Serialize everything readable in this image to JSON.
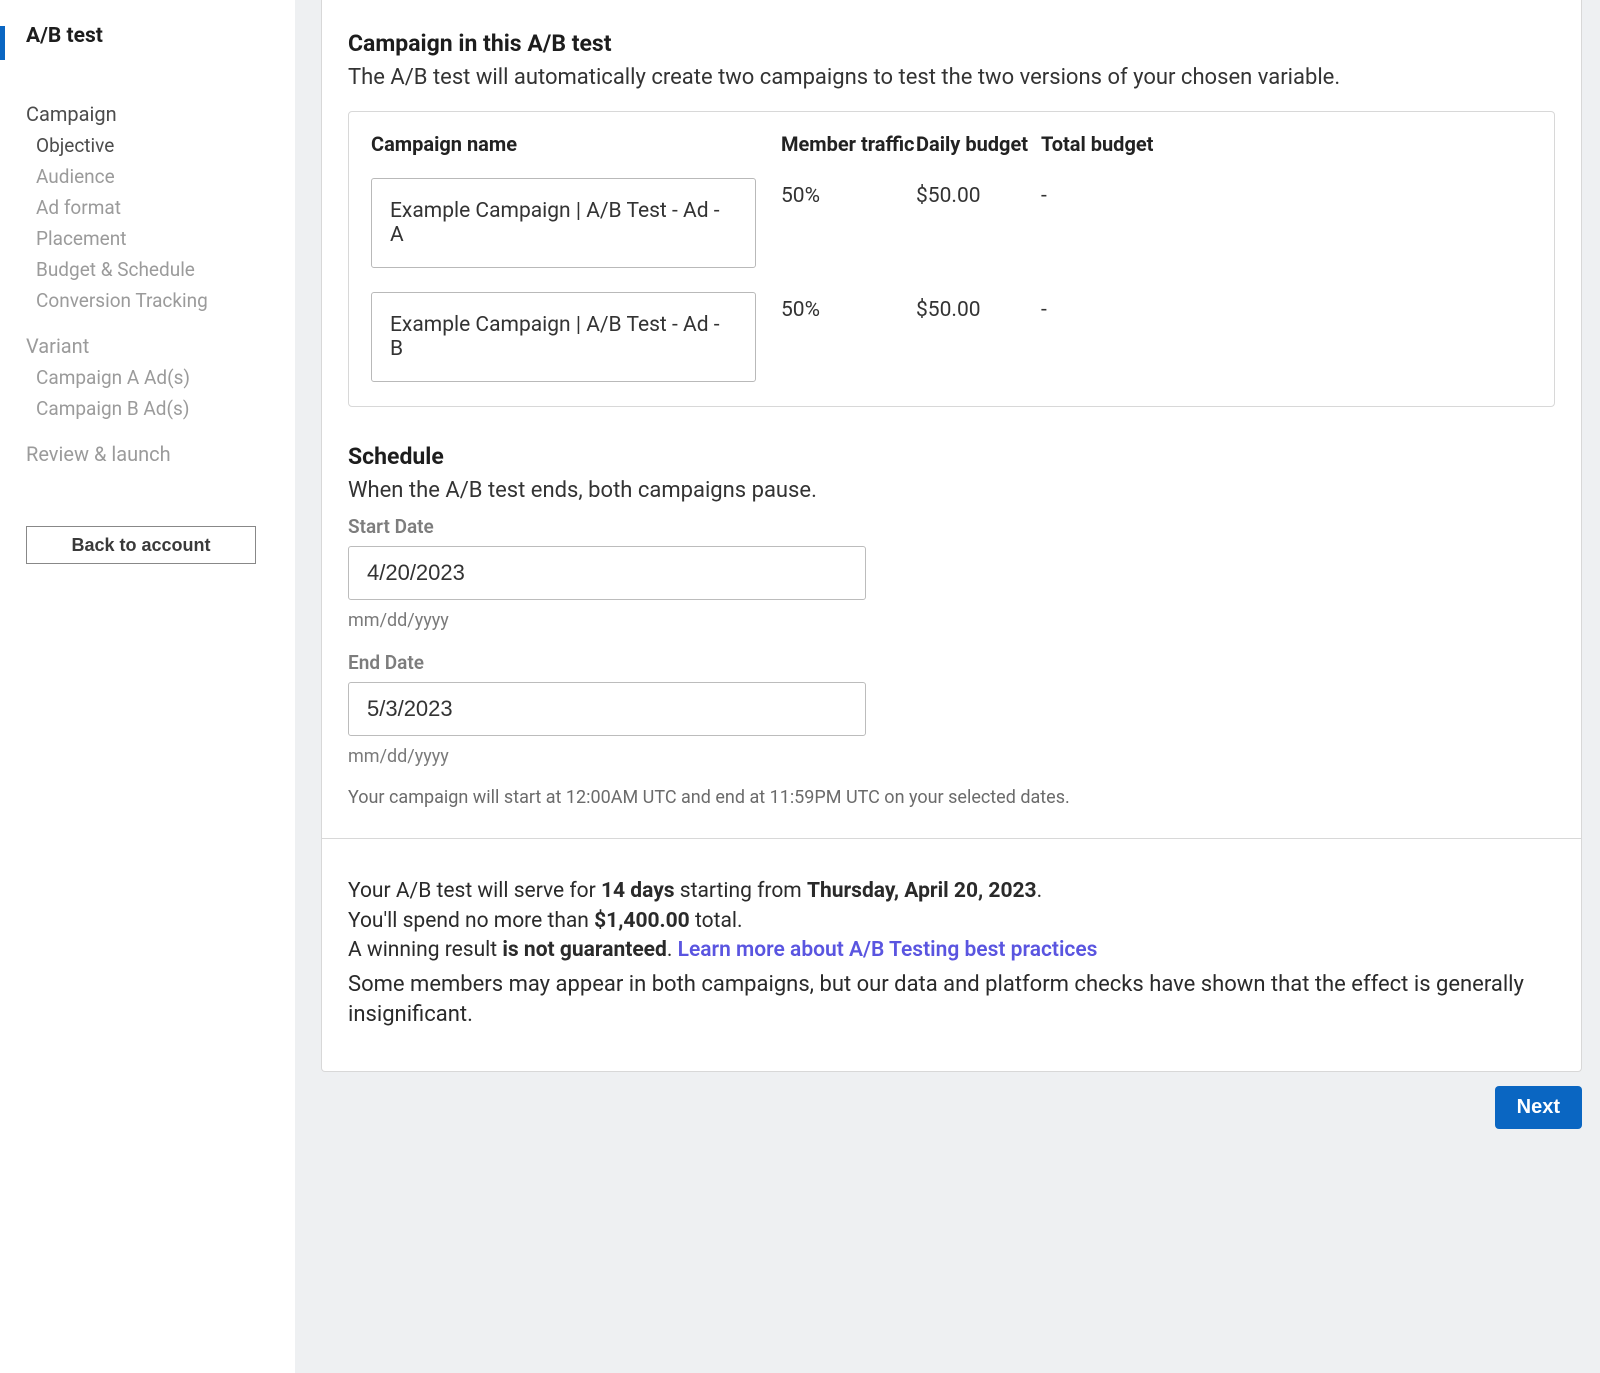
{
  "sidebar": {
    "top_title": "A/B test",
    "campaign_title": "Campaign",
    "campaign_items": [
      "Objective",
      "Audience",
      "Ad format",
      "Placement",
      "Budget & Schedule",
      "Conversion Tracking"
    ],
    "variant_title": "Variant",
    "variant_items": [
      "Campaign A Ad(s)",
      "Campaign B Ad(s)"
    ],
    "review_title": "Review & launch",
    "back_label": "Back to account"
  },
  "campaigns_section": {
    "heading": "Campaign in this A/B test",
    "desc": "The A/B test will automatically create two campaigns to test the two versions of your chosen variable.",
    "columns": {
      "name": "Campaign name",
      "traffic": "Member traffic",
      "daily": "Daily budget",
      "total": "Total budget"
    },
    "rows": [
      {
        "name": "Example Campaign | A/B Test - Ad - A",
        "traffic": "50%",
        "daily": "$50.00",
        "total": "-"
      },
      {
        "name": "Example Campaign | A/B Test - Ad - B",
        "traffic": "50%",
        "daily": "$50.00",
        "total": "-"
      }
    ]
  },
  "schedule": {
    "heading": "Schedule",
    "desc": "When the A/B test ends, both campaigns pause.",
    "start_label": "Start Date",
    "start_value": "4/20/2023",
    "end_label": "End Date",
    "end_value": "5/3/2023",
    "format_hint": "mm/dd/yyyy",
    "note": "Your campaign will start at 12:00AM UTC and end at 11:59PM UTC on your selected dates."
  },
  "summary": {
    "line1_pre": "Your A/B test will serve for ",
    "duration": "14 days",
    "line1_mid": " starting from ",
    "start_date": "Thursday, April 20, 2023",
    "line1_end": ".",
    "line2_pre": "You'll spend no more than ",
    "spend_cap": "$1,400.00",
    "line2_end": " total.",
    "line3_pre": "A winning result ",
    "not_guaranteed": "is not guaranteed",
    "line3_mid": ". ",
    "learn_more": "Learn more about A/B Testing best practices",
    "note": "Some members may appear in both campaigns, but our data and platform checks have shown that the effect is generally insignificant."
  },
  "footer": {
    "next_label": "Next"
  }
}
